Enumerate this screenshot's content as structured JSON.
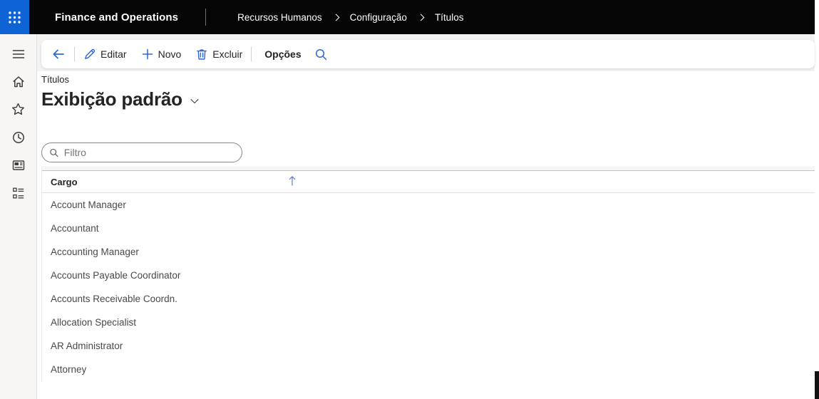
{
  "topbar": {
    "brand": "Finance and Operations",
    "breadcrumb": [
      "Recursos Humanos",
      "Configuração",
      "Títulos"
    ],
    "bg_color": "#050505",
    "waffle_color": "#0E64D4"
  },
  "sidebar": {
    "icons": [
      "menu-icon",
      "home-icon",
      "favorites-star-icon",
      "recent-clock-icon",
      "default-dashboard-icon",
      "modules-list-icon"
    ]
  },
  "toolbar": {
    "icon_color": "#2866DD",
    "back_icon": "back-arrow-icon",
    "buttons": [
      {
        "label": "Editar",
        "icon": "pencil-icon"
      },
      {
        "label": "Novo",
        "icon": "plus-icon"
      },
      {
        "label": "Excluir",
        "icon": "trash-icon"
      }
    ],
    "options_label": "Opções",
    "search_icon": "search-icon"
  },
  "page": {
    "subtitle": "Títulos",
    "title": "Exibição padrão",
    "filter_placeholder": "Filtro"
  },
  "grid": {
    "columns": [
      {
        "label": "Cargo",
        "sort": "ascending"
      }
    ],
    "rows": [
      "Account Manager",
      "Accountant",
      "Accounting Manager",
      "Accounts Payable Coordinator",
      "Accounts Receivable Coordn.",
      "Allocation Specialist",
      "AR Administrator",
      "Attorney"
    ]
  }
}
